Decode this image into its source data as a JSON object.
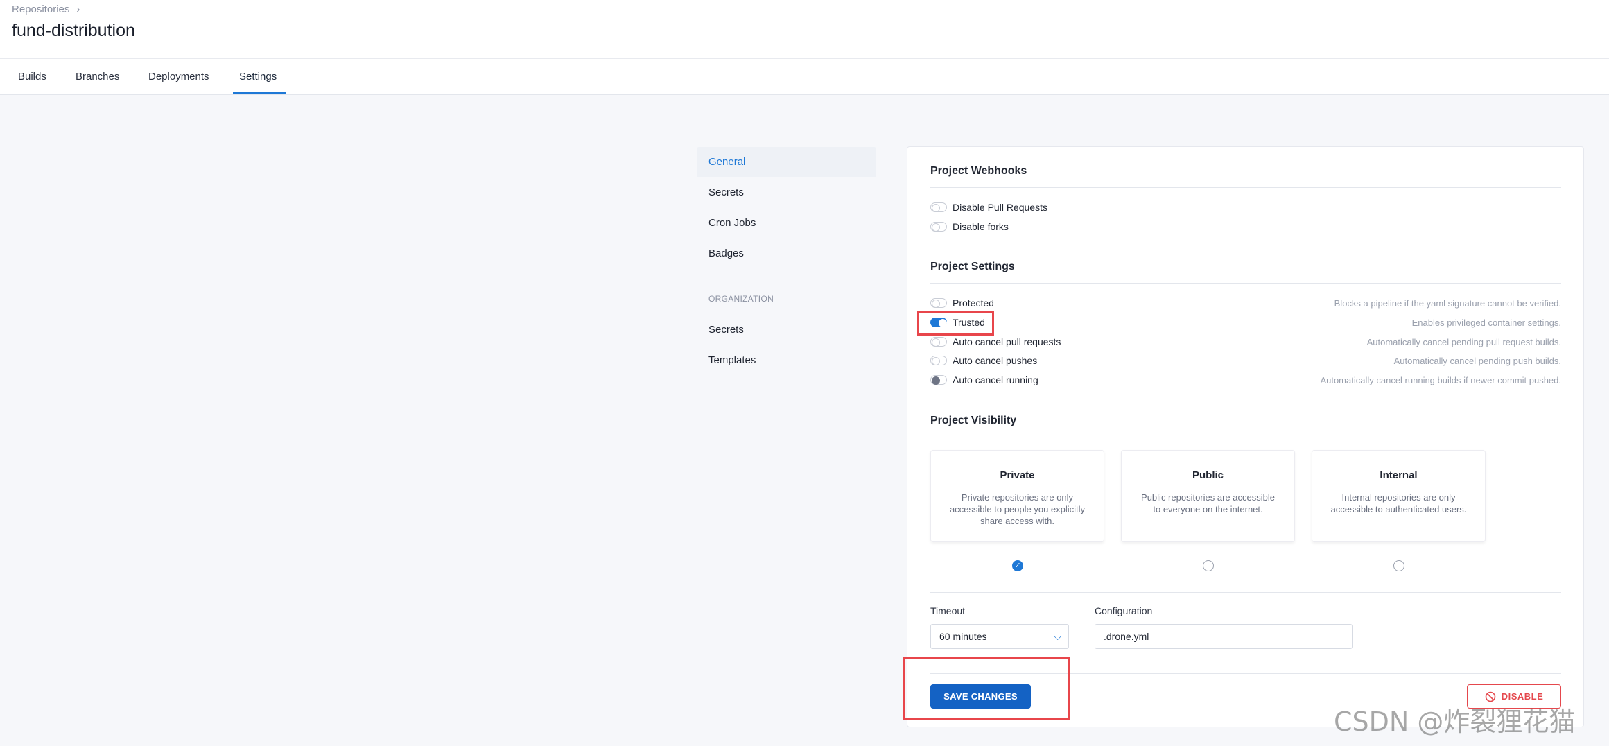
{
  "breadcrumb": {
    "parent": "Repositories"
  },
  "repo": {
    "name": "fund-distribution"
  },
  "tabs": [
    {
      "label": "Builds"
    },
    {
      "label": "Branches"
    },
    {
      "label": "Deployments"
    },
    {
      "label": "Settings",
      "active": true
    }
  ],
  "sidebar": {
    "items": [
      {
        "label": "General",
        "active": true
      },
      {
        "label": "Secrets"
      },
      {
        "label": "Cron Jobs"
      },
      {
        "label": "Badges"
      }
    ],
    "org_section": "ORGANIZATION",
    "org_items": [
      {
        "label": "Secrets"
      },
      {
        "label": "Templates"
      }
    ]
  },
  "webhooks": {
    "title": "Project Webhooks",
    "toggles": [
      {
        "label": "Disable Pull Requests",
        "on": false
      },
      {
        "label": "Disable forks",
        "on": false
      }
    ]
  },
  "settings": {
    "title": "Project Settings",
    "toggles": [
      {
        "label": "Protected",
        "desc": "Blocks a pipeline if the yaml signature cannot be verified.",
        "on": false
      },
      {
        "label": "Trusted",
        "desc": "Enables privileged container settings.",
        "on": true
      },
      {
        "label": "Auto cancel pull requests",
        "desc": "Automatically cancel pending pull request builds.",
        "on": false
      },
      {
        "label": "Auto cancel pushes",
        "desc": "Automatically cancel pending push builds.",
        "on": false
      },
      {
        "label": "Auto cancel running",
        "desc": "Automatically cancel running builds if newer commit pushed.",
        "on": false
      }
    ]
  },
  "visibility": {
    "title": "Project Visibility",
    "options": [
      {
        "title": "Private",
        "desc": "Private repositories are only accessible to people you explicitly share access with.",
        "selected": true
      },
      {
        "title": "Public",
        "desc": "Public repositories are accessible to everyone on the internet.",
        "selected": false
      },
      {
        "title": "Internal",
        "desc": "Internal repositories are only accessible to authenticated users.",
        "selected": false
      }
    ]
  },
  "timeout": {
    "label": "Timeout",
    "value": "60 minutes"
  },
  "configuration": {
    "label": "Configuration",
    "value": ".drone.yml"
  },
  "actions": {
    "save_label": "SAVE CHANGES",
    "disable_label": "DISABLE"
  },
  "watermark": "CSDN @炸裂狸花猫",
  "colors": {
    "accent": "#1e78d6",
    "danger": "#e5484d",
    "highlight": "#e8464b"
  }
}
